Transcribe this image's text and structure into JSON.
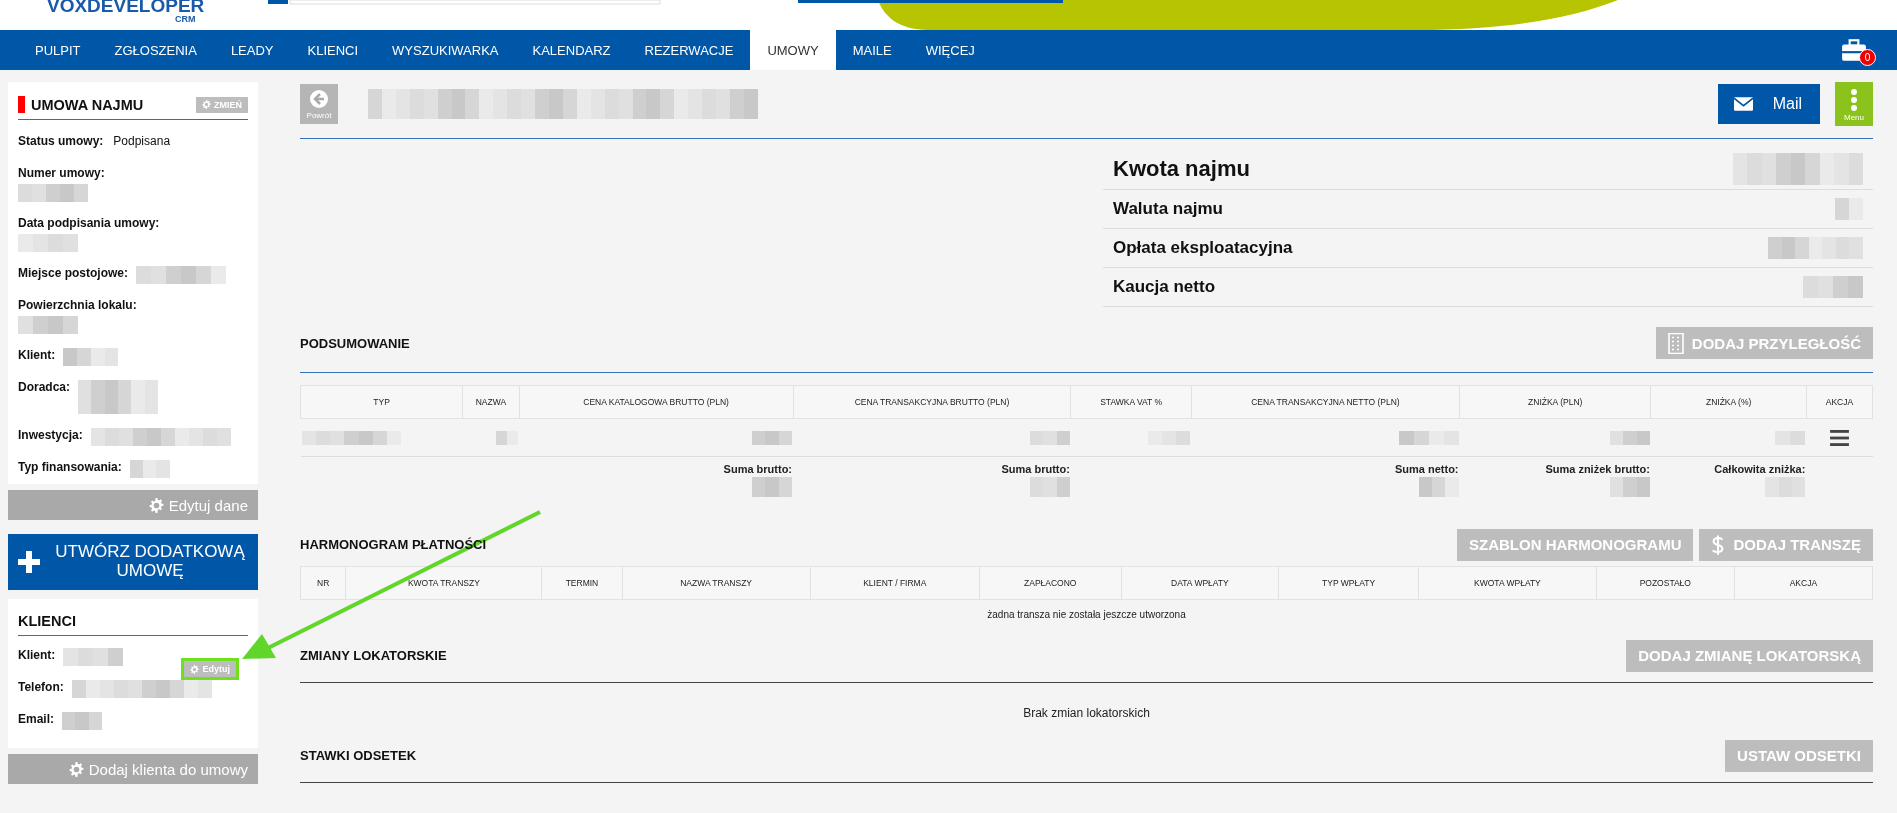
{
  "header": {
    "logo": "VOXDEVELOPER",
    "logo_sub": "CRM"
  },
  "nav": {
    "items": [
      {
        "label": "PULPIT",
        "selected": false
      },
      {
        "label": "ZGŁOSZENIA",
        "selected": false
      },
      {
        "label": "LEADY",
        "selected": false
      },
      {
        "label": "KLIENCI",
        "selected": false
      },
      {
        "label": "WYSZUKIWARKA",
        "selected": false
      },
      {
        "label": "KALENDARZ",
        "selected": false
      },
      {
        "label": "REZERWACJE",
        "selected": false
      },
      {
        "label": "UMOWY",
        "selected": true
      },
      {
        "label": "MAILE",
        "selected": false
      },
      {
        "label": "WIĘCEJ",
        "selected": false
      }
    ],
    "badge": "0"
  },
  "contract_panel": {
    "title": "UMOWA NAJMU",
    "change_button": "ZMIEŃ",
    "fields": [
      {
        "label": "Status umowy:",
        "kind": "inline",
        "value": "Podpisana"
      },
      {
        "label": "Numer umowy:",
        "kind": "below-blurred"
      },
      {
        "label": "Data podpisania umowy:",
        "kind": "below-blurred"
      },
      {
        "label": "Miejsce postojowe:",
        "kind": "inline-blurred"
      },
      {
        "label": "Powierzchnia lokalu:",
        "kind": "below-blurred"
      },
      {
        "label": "Klient:",
        "kind": "inline-blurred"
      },
      {
        "label": "Doradca:",
        "kind": "tall-blurred"
      },
      {
        "label": "Inwestycja:",
        "kind": "inline-blurred"
      },
      {
        "label": "Typ finansowania:",
        "kind": "inline-blurred"
      }
    ],
    "edit_button": "Edytuj dane"
  },
  "create_button": "UTWÓRZ DODATKOWĄ UMOWĘ",
  "clients_panel": {
    "title": "KLIENCI",
    "fields": [
      {
        "label": "Klient:",
        "kind": "inline-blurred"
      },
      {
        "label": "Telefon:",
        "kind": "inline-blurred"
      },
      {
        "label": "Email:",
        "kind": "inline-blurred"
      }
    ],
    "edit_button": {
      "label": "Edytuj",
      "highlighted": true
    },
    "add_button": "Dodaj klienta do umowy"
  },
  "toolbar": {
    "back_label": "Powrót",
    "mail_button": "Mail",
    "menu_label": "Menu"
  },
  "amounts": [
    {
      "label": "Kwota najmu",
      "emphasis": true
    },
    {
      "label": "Waluta najmu",
      "emphasis": false
    },
    {
      "label": "Opłata eksploatacyjna",
      "emphasis": false
    },
    {
      "label": "Kaucja netto",
      "emphasis": false
    }
  ],
  "summary": {
    "title": "PODSUMOWANIE",
    "button": "DODAJ PRZYLEGŁOŚĆ",
    "columns": [
      {
        "label": "TYP"
      },
      {
        "label": "NAZWA"
      },
      {
        "label": "CENA KATALOGOWA BRUTTO (PLN)",
        "total": "Suma brutto:"
      },
      {
        "label": "CENA TRANSAKCYJNA BRUTTO (PLN)",
        "total": "Suma brutto:"
      },
      {
        "label": "STAWKA VAT %"
      },
      {
        "label": "CENA TRANSAKCYJNA NETTO (PLN)",
        "total": "Suma netto:"
      },
      {
        "label": "ZNIŻKA (PLN)",
        "total": "Suma zniżek brutto:"
      },
      {
        "label": "ZNIŻKA (%)",
        "total": "Całkowita zniżka:"
      },
      {
        "label": "AKCJA"
      }
    ],
    "rows": [
      {
        "redacted": true
      }
    ]
  },
  "schedule": {
    "title": "HARMONOGRAM PŁATNOŚCI",
    "buttons": [
      {
        "label": "SZABLON HARMONOGRAMU",
        "kind": "plain"
      },
      {
        "label": "DODAJ TRANSZĘ",
        "kind": "dollar"
      }
    ],
    "columns": [
      "NR",
      "KWOTA TRANSZY",
      "TERMIN",
      "NAZWA TRANSZY",
      "KLIENT / FIRMA",
      "ZAPŁACONO",
      "DATA WPŁATY",
      "TYP WPŁATY",
      "KWOTA WPŁATY",
      "POZOSTAŁO",
      "AKCJA"
    ],
    "empty_message": "żadna transza nie została jeszcze utworzona"
  },
  "tenant_changes": {
    "title": "ZMIANY LOKATORSKIE",
    "button": "DODAJ ZMIANĘ LOKATORSKĄ",
    "empty_message": "Brak zmian lokatorskich"
  },
  "interest_rates": {
    "title": "STAWKI ODSETEK",
    "button": "USTAW ODSETKI"
  },
  "annotation": {
    "kind": "arrow"
  }
}
